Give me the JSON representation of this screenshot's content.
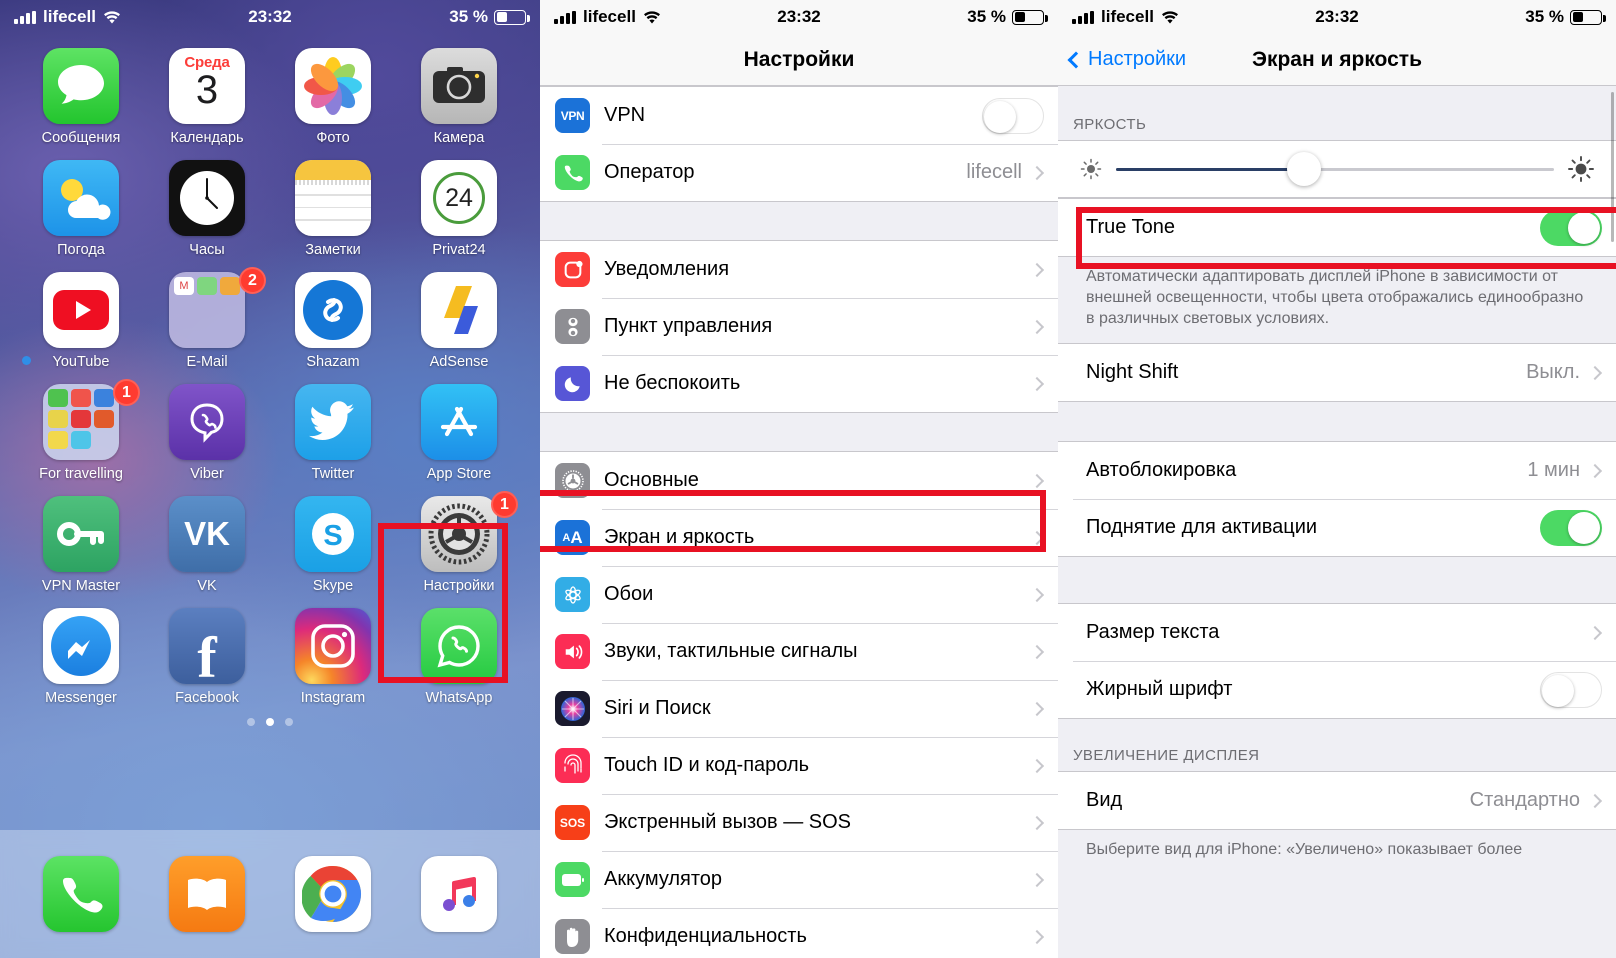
{
  "status_bar": {
    "carrier": "lifecell",
    "time": "23:32",
    "battery": "35 %",
    "battery_level": 35
  },
  "home": {
    "apps": [
      {
        "label": "Сообщения",
        "icon": "messages-icon",
        "badge": null
      },
      {
        "label": "Календарь",
        "icon": "calendar-icon",
        "badge": null,
        "weekday": "Среда",
        "day": "3"
      },
      {
        "label": "Фото",
        "icon": "photos-icon",
        "badge": null
      },
      {
        "label": "Камера",
        "icon": "camera-icon",
        "badge": null
      },
      {
        "label": "Погода",
        "icon": "weather-icon",
        "badge": null
      },
      {
        "label": "Часы",
        "icon": "clock-icon",
        "badge": null
      },
      {
        "label": "Заметки",
        "icon": "notes-icon",
        "badge": null
      },
      {
        "label": "Privat24",
        "icon": "privat24-icon",
        "badge": null,
        "glyph": "24"
      },
      {
        "label": "YouTube",
        "icon": "youtube-icon",
        "badge": null,
        "new_dot": true
      },
      {
        "label": "E-Mail",
        "icon": "email-folder-icon",
        "badge": "2"
      },
      {
        "label": "Shazam",
        "icon": "shazam-icon",
        "badge": null
      },
      {
        "label": "AdSense",
        "icon": "adsense-icon",
        "badge": null
      },
      {
        "label": "For travelling",
        "icon": "travel-folder-icon",
        "badge": "1"
      },
      {
        "label": "Viber",
        "icon": "viber-icon",
        "badge": null
      },
      {
        "label": "Twitter",
        "icon": "twitter-icon",
        "badge": null
      },
      {
        "label": "App Store",
        "icon": "appstore-icon",
        "badge": null
      },
      {
        "label": "VPN Master",
        "icon": "vpnmaster-icon",
        "badge": null
      },
      {
        "label": "VK",
        "icon": "vk-icon",
        "badge": null
      },
      {
        "label": "Skype",
        "icon": "skype-icon",
        "badge": null
      },
      {
        "label": "Настройки",
        "icon": "settings-gear-icon",
        "badge": "1",
        "highlighted": true
      },
      {
        "label": "Messenger",
        "icon": "messenger-icon",
        "badge": null
      },
      {
        "label": "Facebook",
        "icon": "facebook-icon",
        "badge": null
      },
      {
        "label": "Instagram",
        "icon": "instagram-icon",
        "badge": null
      },
      {
        "label": "WhatsApp",
        "icon": "whatsapp-icon",
        "badge": null
      }
    ],
    "page_dots": {
      "count": 3,
      "active_index": 1
    },
    "dock": [
      {
        "label": "Телефон",
        "icon": "phone-icon"
      },
      {
        "label": "Книги",
        "icon": "ibooks-icon"
      },
      {
        "label": "Chrome",
        "icon": "chrome-icon"
      },
      {
        "label": "Музыка",
        "icon": "music-icon"
      }
    ]
  },
  "settings": {
    "title": "Настройки",
    "group_top": [
      {
        "label": "VPN",
        "icon": "vpn-icon",
        "control": "toggle-off"
      },
      {
        "label": "Оператор",
        "icon": "carrier-phone-icon",
        "value": "lifecell",
        "control": "chevron"
      }
    ],
    "group_notifications": [
      {
        "label": "Уведомления",
        "icon": "notifications-icon",
        "control": "chevron"
      },
      {
        "label": "Пункт управления",
        "icon": "control-center-icon",
        "control": "chevron"
      },
      {
        "label": "Не беспокоить",
        "icon": "do-not-disturb-icon",
        "control": "chevron"
      }
    ],
    "group_general": [
      {
        "label": "Основные",
        "icon": "general-gear-icon",
        "control": "chevron"
      },
      {
        "label": "Экран и яркость",
        "icon": "display-brightness-icon",
        "control": "chevron",
        "highlighted": true
      },
      {
        "label": "Обои",
        "icon": "wallpaper-icon",
        "control": "chevron"
      },
      {
        "label": "Звуки, тактильные сигналы",
        "icon": "sounds-icon",
        "control": "chevron"
      },
      {
        "label": "Siri и Поиск",
        "icon": "siri-icon",
        "control": "chevron"
      },
      {
        "label": "Touch ID и код-пароль",
        "icon": "touchid-icon",
        "control": "chevron"
      },
      {
        "label": "Экстренный вызов — SOS",
        "icon": "sos-icon",
        "control": "chevron",
        "glyph": "SOS"
      },
      {
        "label": "Аккумулятор",
        "icon": "battery-icon",
        "control": "chevron"
      },
      {
        "label": "Конфиденциальность",
        "icon": "privacy-hand-icon",
        "control": "chevron"
      }
    ]
  },
  "display": {
    "back_label": "Настройки",
    "title": "Экран и яркость",
    "brightness_header": "ЯРКОСТЬ",
    "brightness_value": 43,
    "true_tone": {
      "label": "True Tone",
      "state": "on",
      "highlighted": true
    },
    "true_tone_footer": "Автоматически адаптировать дисплей iPhone в зависимости от внешней освещенности, чтобы цвета отображались единообразно в различных световых условиях.",
    "night_shift": {
      "label": "Night Shift",
      "value": "Выкл."
    },
    "auto_lock": {
      "label": "Автоблокировка",
      "value": "1 мин"
    },
    "raise_to_wake": {
      "label": "Поднятие для активации",
      "state": "on"
    },
    "text_size": {
      "label": "Размер текста"
    },
    "bold_text": {
      "label": "Жирный шрифт",
      "state": "off"
    },
    "zoom_header": "УВЕЛИЧЕНИЕ ДИСПЛЕЯ",
    "view": {
      "label": "Вид",
      "value": "Стандартно"
    },
    "zoom_footer": "Выберите вид для iPhone: «Увеличено» показывает более"
  },
  "colors": {
    "accent": "#007aff",
    "highlight": "#e81123",
    "toggle_on": "#4cd964"
  }
}
